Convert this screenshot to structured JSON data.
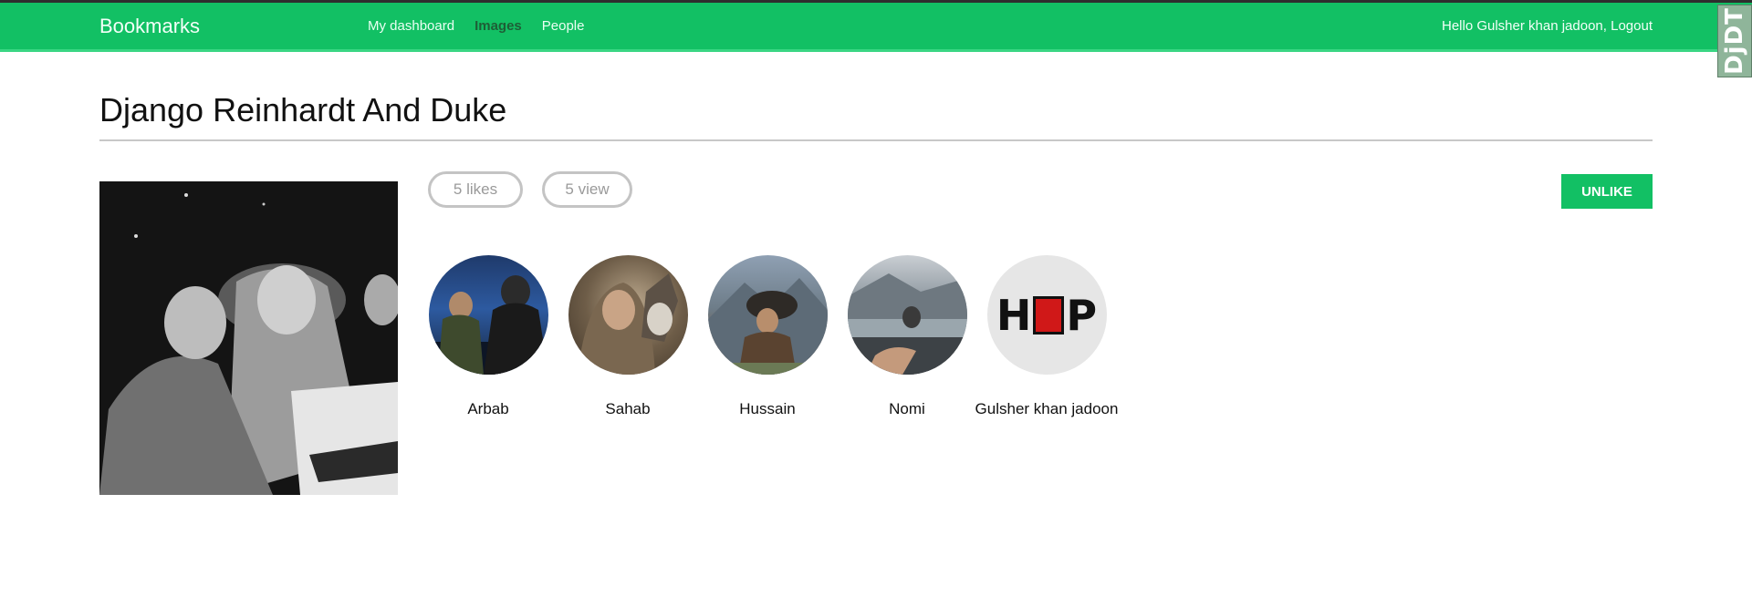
{
  "navbar": {
    "brand": "Bookmarks",
    "links": [
      "My dashboard",
      "Images",
      "People"
    ],
    "active_link": "Images",
    "greeting": "Hello Gulsher khan jadoon,",
    "logout": "Logout",
    "accent": "#12c064"
  },
  "debug_toolbar": {
    "label": "DjDT"
  },
  "image": {
    "title": "Django Reinhardt And Duke",
    "likes": "5 likes",
    "views": "5 view",
    "action_label": "UNLIKE"
  },
  "users": [
    {
      "name": "Arbab"
    },
    {
      "name": "Sahab"
    },
    {
      "name": "Hussain"
    },
    {
      "name": "Nomi"
    },
    {
      "name": "Gulsher khan jadoon",
      "logo_text": "HOP"
    }
  ]
}
